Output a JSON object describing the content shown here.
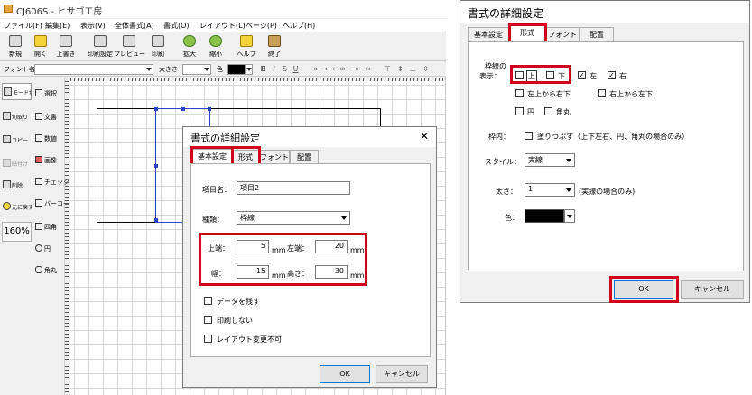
{
  "app": {
    "title": "CJ606S - ヒサゴ工房",
    "menu": [
      "ファイル(F)",
      "編集(E)",
      "表示(V)",
      "全体書式(A)",
      "書式(O)",
      "レイアウト(L)",
      "ページ(P)",
      "ヘルプ(H)"
    ],
    "toolbar": [
      "新規",
      "開く",
      "上書き",
      "印刷設定",
      "プレビュー",
      "印刷",
      "拡大",
      "縮小",
      "ヘルプ",
      "終了"
    ],
    "fontbar": {
      "font_label": "フォント名",
      "size_label": "大きさ",
      "color_label": "色",
      "format_buttons": [
        "B",
        "I",
        "S",
        "U"
      ]
    },
    "left_tools": [
      "モード切替",
      "切取り",
      "コピー",
      "貼付け",
      "削除",
      "元に戻す"
    ],
    "zoom": "160%",
    "object_tools": [
      "選択",
      "文書",
      "数値",
      "画像",
      "チェック",
      "バーコード",
      "四角",
      "円",
      "角丸"
    ]
  },
  "dialog_left": {
    "title": "書式の詳細設定",
    "tabs": [
      "基本設定",
      "形式",
      "フォント",
      "配置"
    ],
    "item_name_label": "項目名：",
    "item_name_value": "項目2",
    "type_label": "種類：",
    "type_value": "枠線",
    "top_label": "上端：",
    "top_value": "5",
    "left_label": "左端：",
    "left_value": "20",
    "width_label": "幅：",
    "width_value": "15",
    "height_label": "高さ：",
    "height_value": "30",
    "unit": "mm",
    "check_keep_data": "データを残す",
    "check_no_print": "印刷しない",
    "check_no_layout_change": "レイアウト変更不可",
    "ok": "OK",
    "cancel": "キャンセル"
  },
  "dialog_right": {
    "title": "書式の詳細設定",
    "tabs": [
      "基本設定",
      "形式",
      "フォント",
      "配置"
    ],
    "border_label_1": "枠線の",
    "border_label_2": "表示：",
    "border_top": "上",
    "border_bottom": "下",
    "border_left": "左",
    "border_right": "右",
    "diag_tl_br": "左上から右下",
    "diag_tr_bl": "右上から左下",
    "circle": "円",
    "round": "角丸",
    "fill_label": "枠内：",
    "fill_option": "塗りつぶす（上下左右、円、角丸の場合のみ）",
    "style_label": "スタイル：",
    "style_value": "実線",
    "thickness_label": "太さ：",
    "thickness_value": "1",
    "thickness_note": "(実線の場合のみ)",
    "color_label": "色：",
    "ok": "OK",
    "cancel": "キャンセル"
  },
  "colors": {
    "highlight": "#d0021b",
    "selection": "#2b44c7"
  }
}
